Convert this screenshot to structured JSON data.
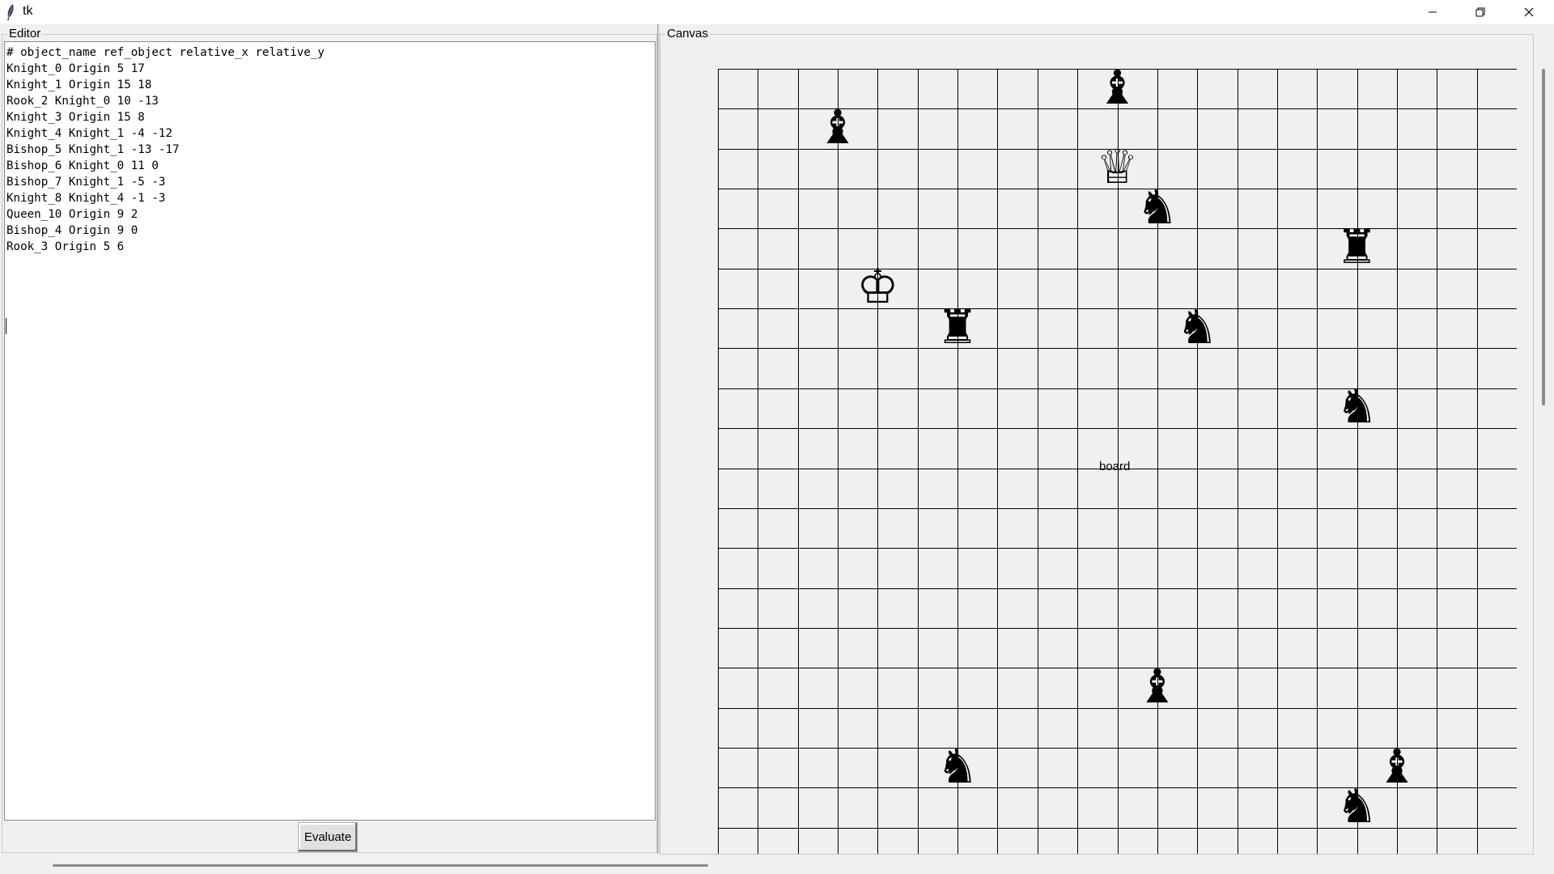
{
  "window": {
    "title": "tk",
    "controls": {
      "minimize_icon": "minimize-icon",
      "maximize_icon": "restore-icon",
      "close_icon": "close-icon"
    }
  },
  "editor": {
    "label": "Editor",
    "lines": [
      "# object_name ref_object relative_x relative_y",
      "Knight_0 Origin 5 17",
      "Knight_1 Origin 15 18",
      "Rook_2 Knight_0 10 -13",
      "Knight_3 Origin 15 8",
      "Knight_4 Knight_1 -4 -12",
      "Bishop_5 Knight_1 -13 -17",
      "Bishop_6 Knight_0 11 0",
      "Bishop_7 Knight_1 -5 -3",
      "Knight_8 Knight_4 -1 -3",
      "Queen_10 Origin 9 2",
      "Bishop_4 Origin 9 0",
      "Rook_3 Origin 5 6"
    ],
    "evaluate_label": "Evaluate"
  },
  "canvas": {
    "label": "Canvas",
    "board": {
      "label": "board",
      "columns": 20,
      "rows": 20,
      "grid_color": "#000000",
      "background": "#f0f0f0"
    },
    "pieces": [
      {
        "name": "Bishop_6",
        "type": "bishop",
        "color": "black",
        "glyph": "♝",
        "col": 2,
        "row": 1
      },
      {
        "name": "Bishop_4",
        "type": "bishop",
        "color": "black",
        "glyph": "♝",
        "col": 9,
        "row": 0
      },
      {
        "name": "Queen_10",
        "type": "queen",
        "color": "white",
        "glyph": "♕",
        "col": 9,
        "row": 2
      },
      {
        "name": "Knight_4",
        "type": "knight",
        "color": "black",
        "glyph": "♞",
        "col": 10,
        "row": 3
      },
      {
        "name": "Rook_2",
        "type": "rook",
        "color": "black",
        "glyph": "♜",
        "col": 15,
        "row": 4
      },
      {
        "name": "King",
        "type": "king",
        "color": "white",
        "glyph": "♔",
        "col": 3,
        "row": 5
      },
      {
        "name": "Rook_3",
        "type": "rook",
        "color": "black",
        "glyph": "♜",
        "col": 5,
        "row": 6
      },
      {
        "name": "Knight_8",
        "type": "knight",
        "color": "black",
        "glyph": "♞",
        "col": 11,
        "row": 6
      },
      {
        "name": "Knight_3",
        "type": "knight",
        "color": "black",
        "glyph": "♞",
        "col": 15,
        "row": 8
      },
      {
        "name": "Bishop_7",
        "type": "bishop",
        "color": "black",
        "glyph": "♝",
        "col": 10,
        "row": 15
      },
      {
        "name": "Knight_0",
        "type": "knight",
        "color": "black",
        "glyph": "♞",
        "col": 5,
        "row": 17
      },
      {
        "name": "Bishop_5",
        "type": "bishop",
        "color": "black",
        "glyph": "♝",
        "col": 16,
        "row": 17
      },
      {
        "name": "Knight_1",
        "type": "knight",
        "color": "black",
        "glyph": "♞",
        "col": 15,
        "row": 18
      }
    ]
  }
}
